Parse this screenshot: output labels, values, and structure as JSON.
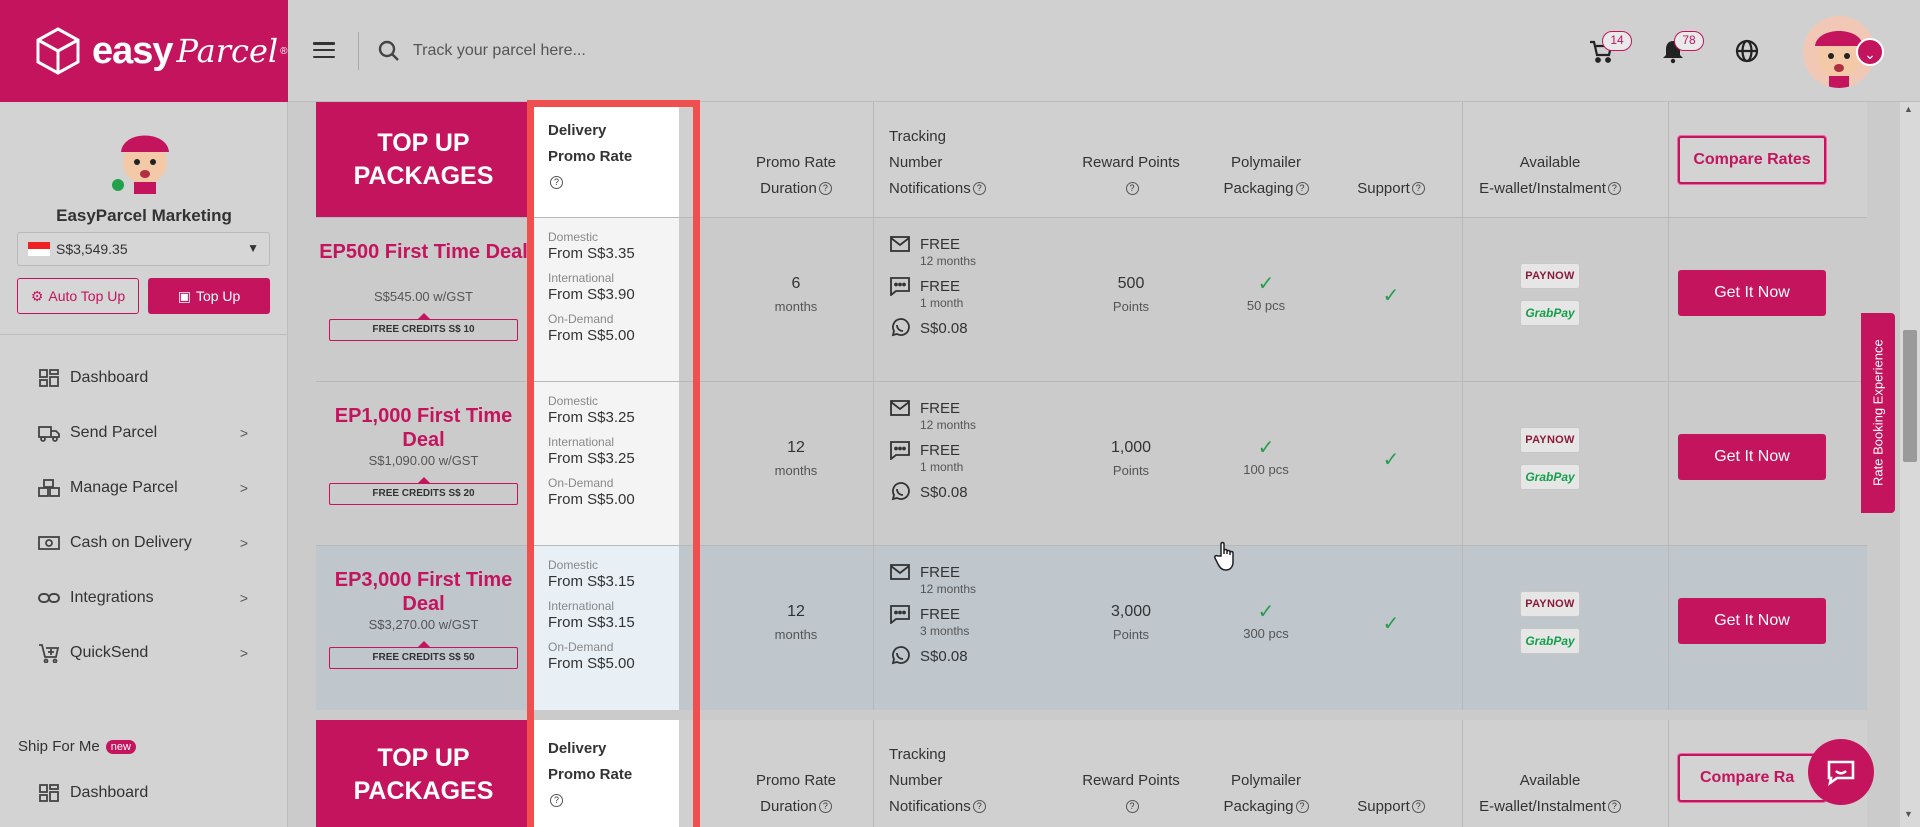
{
  "header": {
    "logo_text_1": "easy",
    "logo_text_2": "Parcel",
    "logo_reg": "®",
    "search_placeholder": "Track your parcel here...",
    "cart_count": "14",
    "notification_count": "78"
  },
  "sidebar": {
    "user_name": "EasyParcel Marketing",
    "balance": "S$3,549.35",
    "auto_topup_label": "Auto Top Up",
    "topup_label": "Top Up",
    "items": [
      {
        "label": "Dashboard",
        "icon": "dashboard-icon"
      },
      {
        "label": "Send Parcel",
        "icon": "truck-icon"
      },
      {
        "label": "Manage Parcel",
        "icon": "boxes-icon"
      },
      {
        "label": "Cash on Delivery",
        "icon": "cash-icon"
      },
      {
        "label": "Integrations",
        "icon": "link-icon"
      },
      {
        "label": "QuickSend",
        "icon": "cart-plus-icon"
      }
    ],
    "ship_for_me": "Ship For Me",
    "new_badge": "new",
    "ship_dashboard": "Dashboard"
  },
  "table": {
    "title_line1": "TOP UP",
    "title_line2": "PACKAGES",
    "col_delivery_1": "Delivery",
    "col_delivery_2": "Promo Rate",
    "col_duration_1": "Promo Rate",
    "col_duration_2": "Duration",
    "col_tracking_1": "Tracking",
    "col_tracking_2": "Number",
    "col_tracking_3": "Notifications",
    "col_points": "Reward Points",
    "col_poly_1": "Polymailer",
    "col_poly_2": "Packaging",
    "col_support": "Support",
    "col_wallet_1": "Available",
    "col_wallet_2": "E-wallet/Instalment",
    "compare_label": "Compare Rates",
    "compare_label_2": "Compare Ra",
    "rate_domestic": "Domestic",
    "rate_international": "International",
    "rate_ondemand": "On-Demand",
    "paynow": "PAYNOW",
    "grabpay": "GrabPay",
    "get_label": "Get It Now",
    "rows": [
      {
        "title": "EP500 First Time Deal",
        "price": "S$545.00 w/GST",
        "credits": "FREE CREDITS S$ 10",
        "domestic": "From S$3.35",
        "international": "From S$3.90",
        "ondemand": "From S$5.00",
        "duration": "6",
        "duration_unit": "months",
        "email": "FREE",
        "email_sub": "12 months",
        "sms": "FREE",
        "sms_sub": "1 month",
        "whatsapp": "S$0.08",
        "points": "500",
        "points_unit": "Points",
        "poly": "50 pcs"
      },
      {
        "title": "EP1,000 First Time Deal",
        "price": "S$1,090.00 w/GST",
        "credits": "FREE CREDITS S$ 20",
        "domestic": "From S$3.25",
        "international": "From S$3.25",
        "ondemand": "From S$5.00",
        "duration": "12",
        "duration_unit": "months",
        "email": "FREE",
        "email_sub": "12 months",
        "sms": "FREE",
        "sms_sub": "1 month",
        "whatsapp": "S$0.08",
        "points": "1,000",
        "points_unit": "Points",
        "poly": "100 pcs"
      },
      {
        "title": "EP3,000 First Time Deal",
        "price": "S$3,270.00 w/GST",
        "credits": "FREE CREDITS S$ 50",
        "domestic": "From S$3.15",
        "international": "From S$3.15",
        "ondemand": "From S$5.00",
        "duration": "12",
        "duration_unit": "months",
        "email": "FREE",
        "email_sub": "12 months",
        "sms": "FREE",
        "sms_sub": "3 months",
        "whatsapp": "S$0.08",
        "points": "3,000",
        "points_unit": "Points",
        "poly": "300 pcs"
      }
    ]
  },
  "side_tab": "Rate Booking Experience",
  "colors": {
    "brand": "#c4145e",
    "highlight": "#ef4f4f",
    "check": "#2a9d4c"
  }
}
